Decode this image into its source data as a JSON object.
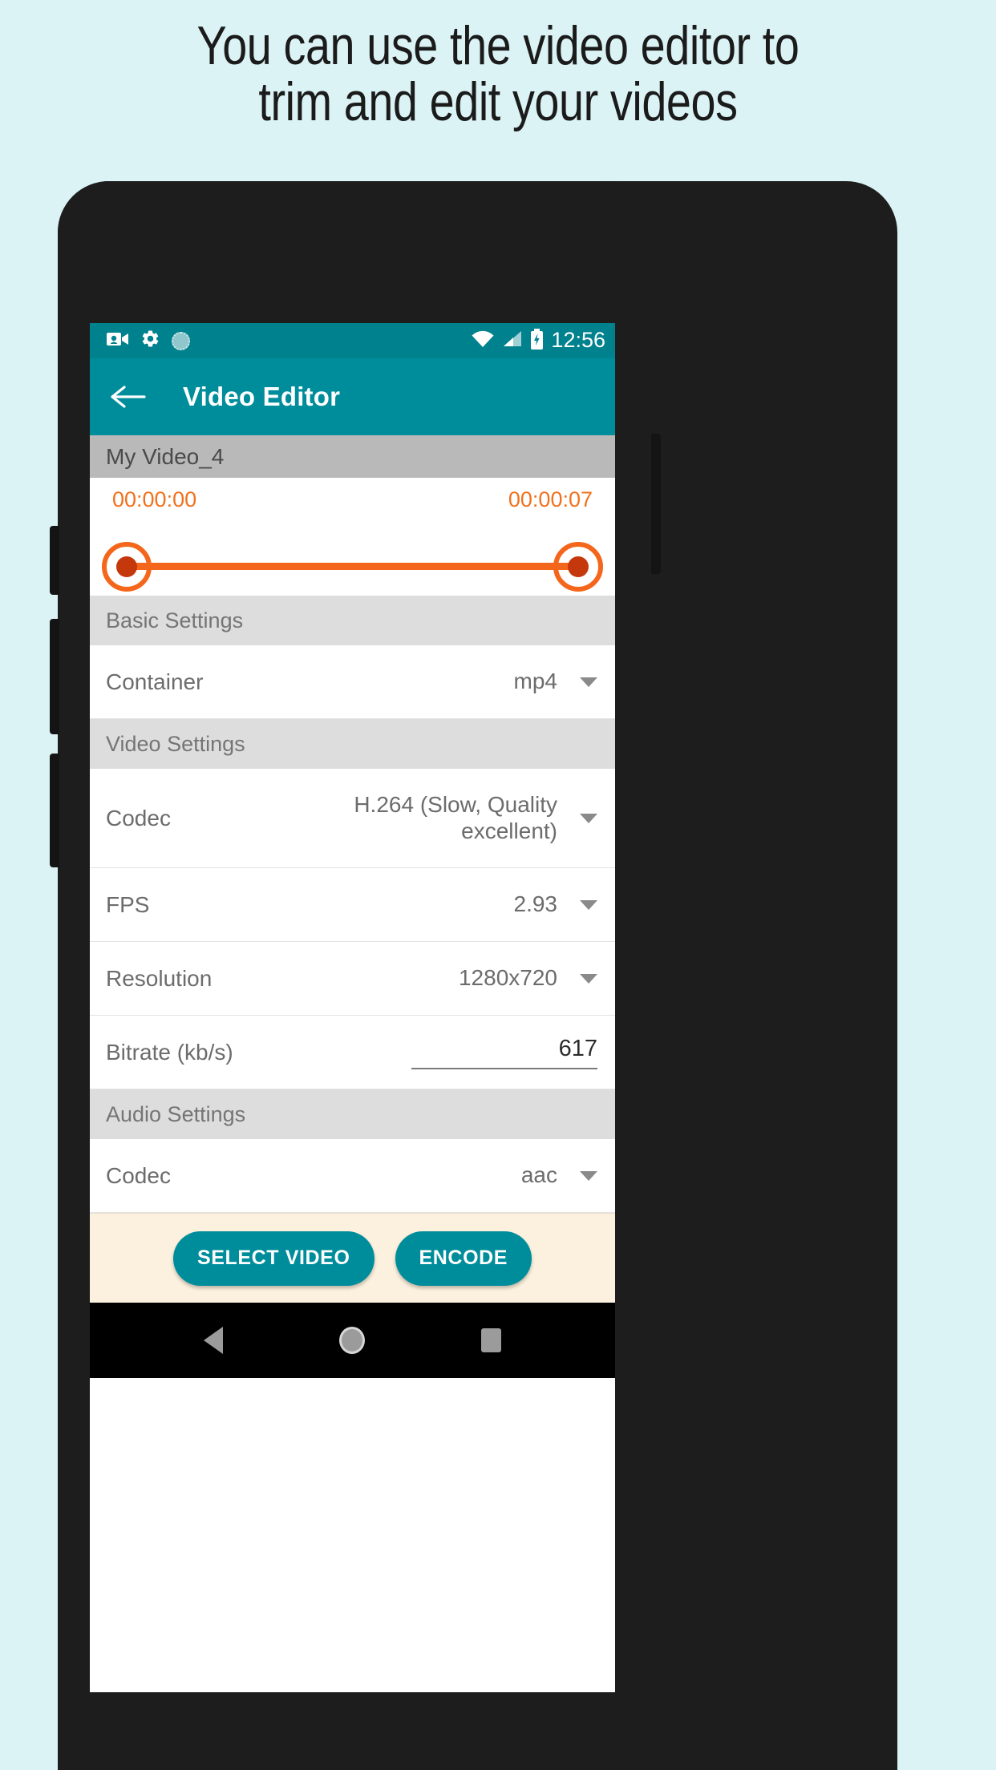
{
  "headline": {
    "line1": "You can use the video editor to",
    "line2": "trim and edit your videos"
  },
  "colors": {
    "page_background": "#dbf3f5",
    "appbar": "#008d9b",
    "statusbar": "#00818e",
    "accent_orange": "#f4661b",
    "action_bar": "#fcf1de",
    "section_grey": "#dddddd",
    "video_name_grey": "#b9b9b9"
  },
  "statusbar": {
    "icons": [
      "video-camera-icon",
      "gear-icon",
      "sync-icon"
    ],
    "right_icons": [
      "wifi-icon",
      "signal-icon",
      "battery-charging-icon"
    ],
    "time": "12:56"
  },
  "appbar": {
    "back_icon": "back-arrow-icon",
    "title": "Video Editor"
  },
  "video": {
    "name": "My Video_4",
    "trim_start": "00:00:00",
    "trim_end": "00:00:07"
  },
  "sections": {
    "basic": "Basic Settings",
    "video": "Video Settings",
    "audio": "Audio Settings"
  },
  "settings": {
    "container": {
      "label": "Container",
      "value": "mp4"
    },
    "video_codec": {
      "label": "Codec",
      "value": "H.264 (Slow, Quality excellent)"
    },
    "fps": {
      "label": "FPS",
      "value": "2.93"
    },
    "resolution": {
      "label": "Resolution",
      "value": "1280x720"
    },
    "bitrate": {
      "label": "Bitrate (kb/s)",
      "value": "617"
    },
    "audio_codec": {
      "label": "Codec",
      "value": "aac"
    }
  },
  "actions": {
    "select_video": "SELECT VIDEO",
    "encode": "ENCODE"
  },
  "navbar": {
    "back": "back-triangle-icon",
    "home": "home-circle-icon",
    "recents": "recents-square-icon"
  }
}
